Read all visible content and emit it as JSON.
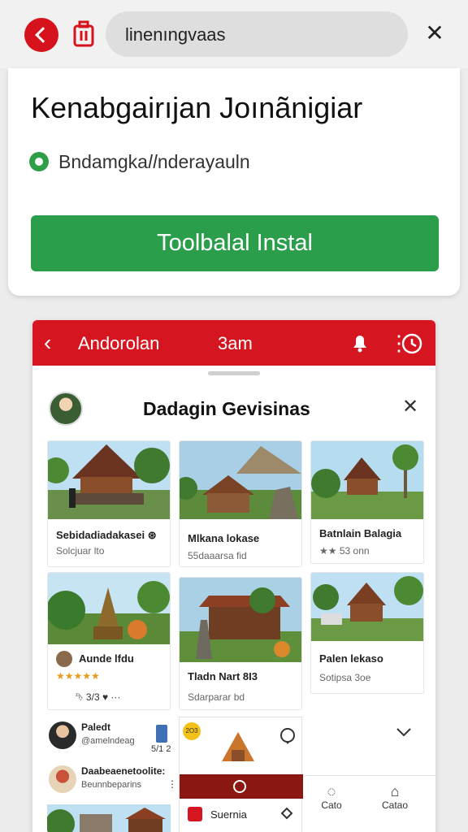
{
  "browser": {
    "url_text": "linenıngvaas",
    "close_glyph": "✕"
  },
  "install_card": {
    "app_title": "Kenabgairıjan Joınãnigiar",
    "developer": "Bndamgka𝑙𝑙nderayauln",
    "install_label": "Toolbalal Instal"
  },
  "app_bar": {
    "back_glyph": "‹",
    "title": "Andorolan",
    "center": "3am",
    "more_glyph": "⋮",
    "color": "#d51620"
  },
  "sheet": {
    "title": "Dadagin Gevisinas",
    "close_glyph": "✕"
  },
  "cards": [
    {
      "title": "Sebidadiadakasei ⊛",
      "sub": "Solcjuar lto"
    },
    {
      "title": "Mlkana lokase",
      "sub": "55daaarsa fid"
    },
    {
      "title": "Batnlain Balagia",
      "sub": "★★ 53 onn"
    },
    {
      "title": "Aunde lfdu",
      "stars": "★★★★★",
      "actions": "⮷ 3/3   ♥   ⋯"
    },
    {
      "title": "Tladn Nart 8I3",
      "sub": "Sdarparar bd"
    },
    {
      "title": "Palen lekaso",
      "sub": "Sotipsa 3oe"
    }
  ],
  "list": [
    {
      "name": "Paledt",
      "sub": "@amelndeag",
      "badge": "5/1 2"
    },
    {
      "name": "Daabeaenetoolite:",
      "sub": "Beunnbeparins",
      "badge": "⋮"
    }
  ],
  "promo": {
    "badge": "2O3",
    "label": "Suernia"
  },
  "nav": [
    {
      "label": "Cato",
      "glyph": "◌"
    },
    {
      "label": "Catao",
      "glyph": "⌂"
    }
  ]
}
